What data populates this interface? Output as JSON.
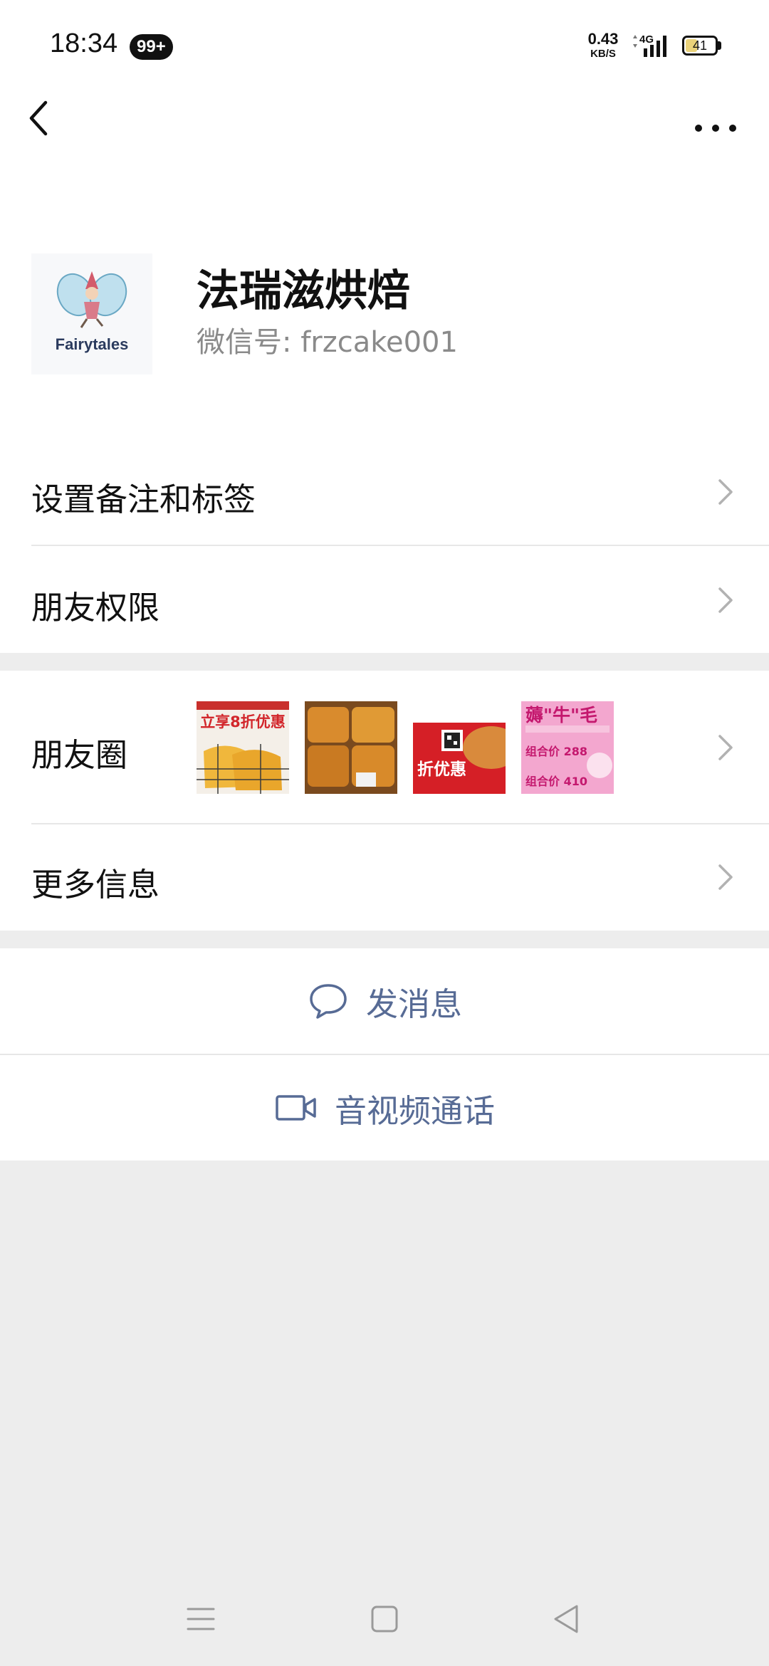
{
  "status_bar": {
    "time": "18:34",
    "notification_badge": "99+",
    "net_speed_value": "0.43",
    "net_speed_unit": "KB/S",
    "network_type": "4G",
    "battery_level": "41"
  },
  "profile": {
    "name": "法瑞滋烘焙",
    "wechat_id": "微信号: frzcake001",
    "avatar_brand": "Fairytales"
  },
  "menu": {
    "remark_tags": "设置备注和标签",
    "friend_permissions": "朋友权限",
    "moments": "朋友圈",
    "more_info": "更多信息"
  },
  "moments_thumbnails": [
    {
      "text_top": "立享8折优惠",
      "kind": "promo-bread"
    },
    {
      "text_top": "",
      "kind": "bread-tray"
    },
    {
      "text_top": "折优惠",
      "kind": "qr-promo"
    },
    {
      "text_top": "薅\"牛\"毛",
      "line1": "组合价 288",
      "line2": "组合价 410",
      "kind": "price-poster"
    }
  ],
  "actions": {
    "send_message": "发消息",
    "video_call": "音视频通话"
  },
  "colors": {
    "link_blue": "#576b95",
    "background_gray": "#ededed",
    "chevron_gray": "#b2b2b2"
  }
}
